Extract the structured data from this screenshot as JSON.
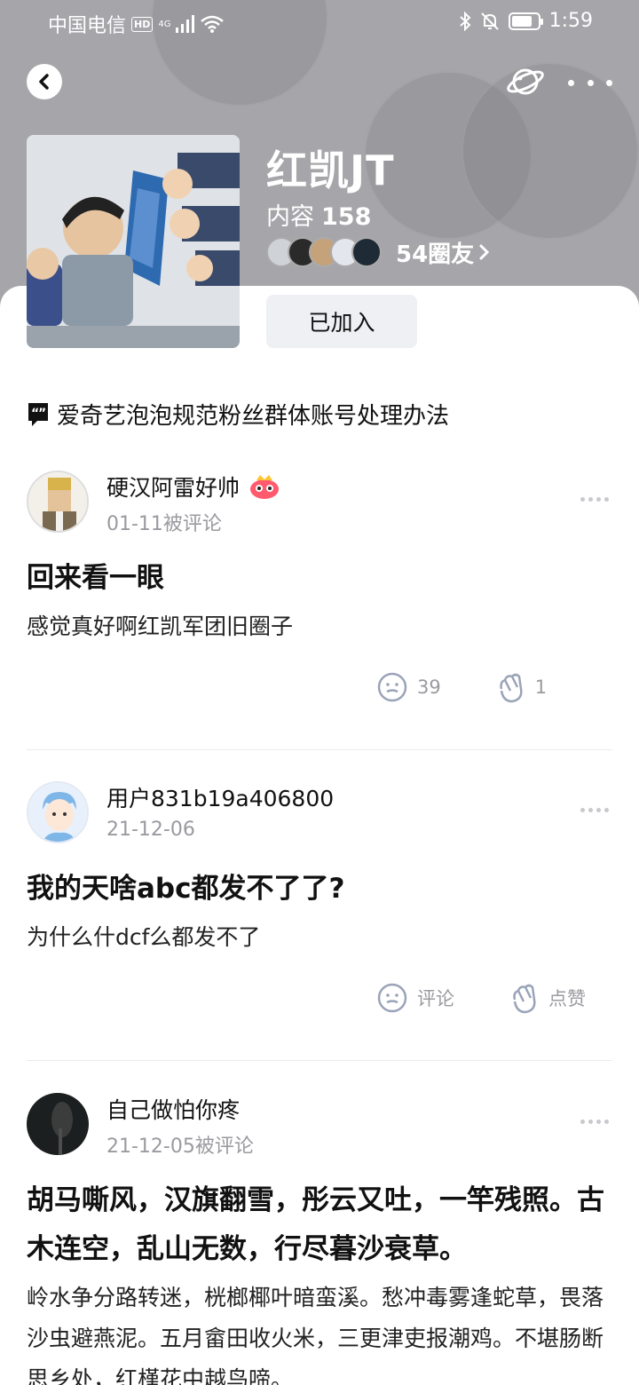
{
  "status_bar": {
    "carrier": "中国电信",
    "hd_badge": "HD",
    "network": "4G",
    "time": "1:59"
  },
  "group": {
    "name": "红凯JT",
    "content_label": "内容",
    "content_count": "158",
    "friends_label": "54圈友",
    "joined_label": "已加入"
  },
  "notice": {
    "text": "爱奇艺泡泡规范粉丝群体账号处理办法"
  },
  "posts": [
    {
      "author": "硬汉阿雷好帅",
      "meta": "01-11被评论",
      "title": "回来看一眼",
      "body": "感觉真好啊红凯军团旧圈子",
      "comments": "39",
      "likes": "1"
    },
    {
      "author": "用户831b19a406800",
      "meta": "21-12-06",
      "title": "我的天啥abc都发不了了?",
      "body": "为什么什dcf么都发不了",
      "comments": "评论",
      "likes": "点赞"
    },
    {
      "author": "自己做怕你疼",
      "meta": "21-12-05被评论",
      "title": "胡马嘶风，汉旗翻雪，彤云又吐，一竿残照。古木连空，乱山无数，行尽暮沙衰草。",
      "body": "岭水争分路转迷，桄榔椰叶暗蛮溪。愁冲毒雾逢蛇草，畏落沙虫避燕泥。五月畲田收火米，三更津吏报潮鸡。不堪肠断思乡处，红槿花中越鸟啼。"
    }
  ],
  "colors": {
    "header_bg": "#a6a6aa",
    "meta_gray": "#9a9aa0",
    "joined_bg": "#eef0f4"
  }
}
